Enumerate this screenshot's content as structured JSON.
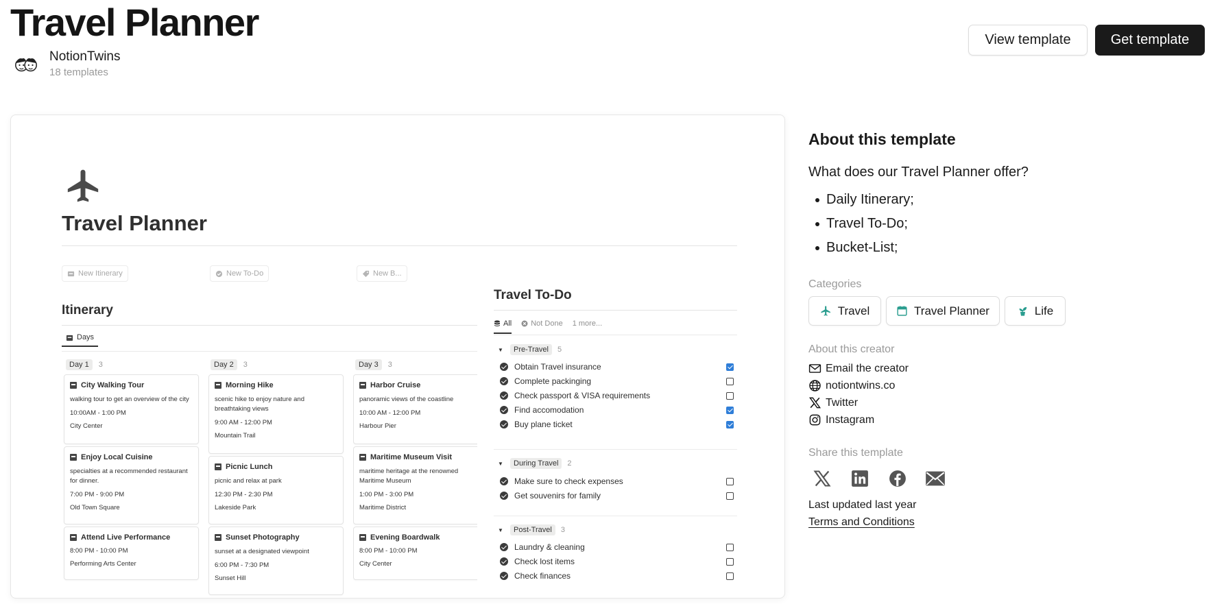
{
  "header": {
    "title": "Travel Planner",
    "creator_name": "NotionTwins",
    "creator_count": "18 templates",
    "view_label": "View template",
    "get_label": "Get template"
  },
  "preview": {
    "title": "Travel Planner",
    "new_buttons": [
      "New Itinerary",
      "New To-Do",
      "New B..."
    ],
    "itinerary": {
      "title": "Itinerary",
      "view_tab": "Days",
      "columns": [
        {
          "label": "Day 1",
          "count": "3",
          "cards": [
            {
              "title": "City Walking Tour",
              "desc": "walking tour to get an overview of the city",
              "time": "10:00AM - 1:00 PM",
              "location": "City Center"
            },
            {
              "title": "Enjoy Local Cuisine",
              "desc": "specialties at a recommended restaurant for dinner.",
              "time": "7:00 PM - 9:00 PM",
              "location": "Old Town Square"
            },
            {
              "title": "Attend Live Performance",
              "desc": "",
              "time": "8:00 PM - 10:00 PM",
              "location": "Performing Arts Center"
            }
          ]
        },
        {
          "label": "Day 2",
          "count": "3",
          "cards": [
            {
              "title": "Morning Hike",
              "desc": "scenic hike to enjoy nature and breathtaking views",
              "time": "9:00 AM - 12:00 PM",
              "location": "Mountain Trail"
            },
            {
              "title": "Picnic Lunch",
              "desc": "picnic and relax at park",
              "time": "12:30 PM - 2:30 PM",
              "location": "Lakeside Park"
            },
            {
              "title": "Sunset Photography",
              "desc": "sunset at a designated viewpoint",
              "time": "6:00 PM - 7:30 PM",
              "location": "Sunset Hill"
            }
          ]
        },
        {
          "label": "Day 3",
          "count": "3",
          "cards": [
            {
              "title": "Harbor Cruise",
              "desc": "panoramic views of the coastline",
              "time": "10:00 AM - 12:00 PM",
              "location": "Harbour Pier"
            },
            {
              "title": "Maritime Museum Visit",
              "desc": "maritime heritage at the renowned Maritime Museum",
              "time": "1:00 PM - 3:00 PM",
              "location": "Maritime District"
            },
            {
              "title": "Evening Boardwalk",
              "desc": "",
              "time": "8:00 PM - 10:00 PM",
              "location": "City Center"
            }
          ]
        }
      ]
    },
    "todo": {
      "title": "Travel To-Do",
      "tabs": {
        "all": "All",
        "not_done": "Not Done",
        "more": "1 more..."
      },
      "groups": [
        {
          "label": "Pre-Travel",
          "count": "5",
          "items": [
            {
              "label": "Obtain Travel insurance",
              "checked": true
            },
            {
              "label": "Complete packinging",
              "checked": false
            },
            {
              "label": "Check passport & VISA requirements",
              "checked": false
            },
            {
              "label": "Find accomodation",
              "checked": true
            },
            {
              "label": "Buy plane ticket",
              "checked": true
            }
          ]
        },
        {
          "label": "During Travel",
          "count": "2",
          "items": [
            {
              "label": "Make sure to check expenses",
              "checked": false
            },
            {
              "label": "Get souvenirs for family",
              "checked": false
            }
          ]
        },
        {
          "label": "Post-Travel",
          "count": "3",
          "items": [
            {
              "label": "Laundry & cleaning",
              "checked": false
            },
            {
              "label": "Check lost items",
              "checked": false
            },
            {
              "label": "Check finances",
              "checked": false
            }
          ]
        }
      ]
    }
  },
  "sidebar": {
    "about_title": "About this template",
    "about_question": "What does our Travel Planner offer?",
    "features": [
      "Daily Itinerary;",
      "Travel To-Do;",
      "Bucket-List;"
    ],
    "categories_label": "Categories",
    "categories": [
      {
        "label": "Travel",
        "icon": "plane-icon"
      },
      {
        "label": "Travel Planner",
        "icon": "calendar-icon"
      },
      {
        "label": "Life",
        "icon": "plant-icon"
      }
    ],
    "creator_label": "About this creator",
    "creator_links": [
      {
        "label": "Email the creator",
        "icon": "mail-icon"
      },
      {
        "label": "notiontwins.co",
        "icon": "globe-icon"
      },
      {
        "label": "Twitter",
        "icon": "x-icon"
      },
      {
        "label": "Instagram",
        "icon": "instagram-icon"
      }
    ],
    "share_label": "Share this template",
    "share_icons": [
      "x-icon",
      "linkedin-icon",
      "facebook-icon",
      "mail-icon"
    ],
    "updated": "Last updated last year",
    "terms": "Terms and Conditions"
  },
  "colors": {
    "accent_teal": "#2a9d8f",
    "checkbox_blue": "#2f7ed8",
    "primary_button": "#1a1a1a"
  }
}
